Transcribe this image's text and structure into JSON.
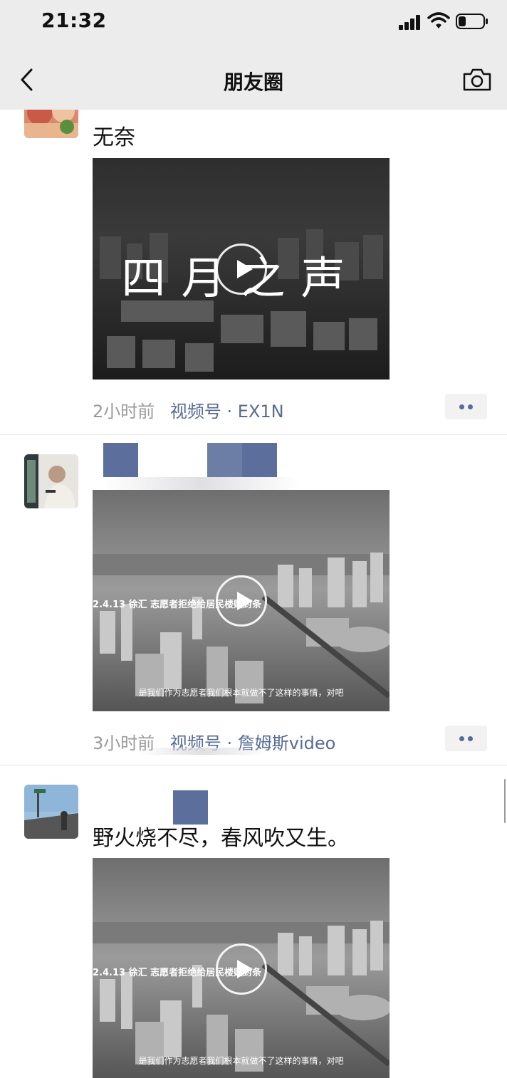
{
  "status_bar": {
    "time": "21:32",
    "battery_level": 0.3
  },
  "nav": {
    "title": "朋友圈",
    "back_icon": "chevron-left-icon",
    "camera_icon": "camera-icon"
  },
  "posts": [
    {
      "text": "无奈",
      "video": {
        "title_overlay": "四月之声"
      },
      "time": "2小时前",
      "source": "视频号 · EX1N"
    },
    {
      "text": "",
      "video": {
        "subtitle_top": "2.4.13 徐汇 志愿者拒绝给居民楼贴封条",
        "subtitle_bottom": "是我们作为志愿者我们根本就做不了这样的事情，对吧"
      },
      "time": "3小时前",
      "source": "视频号 · 詹姆斯video"
    },
    {
      "text": "野火烧不尽，春风吹又生。",
      "video": {
        "subtitle_top": "2.4.13 徐汇 志愿者拒绝给居民楼贴封条",
        "subtitle_bottom": "是我们作为志愿者我们根本就做不了这样的事情，对吧"
      }
    }
  ],
  "colors": {
    "link": "#576b95",
    "meta_gray": "#9a9a9a",
    "bar_bg": "#ececec"
  }
}
